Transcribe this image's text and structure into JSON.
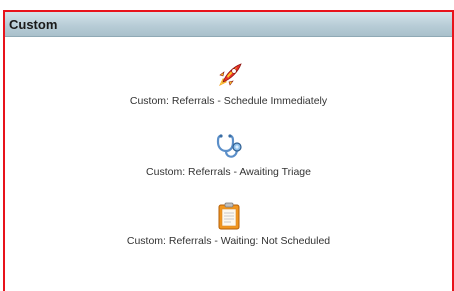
{
  "panel": {
    "title": "Custom",
    "border_color": "#e8131b",
    "header_color": "#b8cdd7"
  },
  "tiles": [
    {
      "label": "Custom: Referrals - Schedule Immediately",
      "icon": "rocket-icon"
    },
    {
      "label": "Custom: Referrals - Awaiting Triage",
      "icon": "stethoscope-icon"
    },
    {
      "label": "Custom: Referrals - Waiting: Not Scheduled",
      "icon": "clipboard-icon"
    }
  ]
}
